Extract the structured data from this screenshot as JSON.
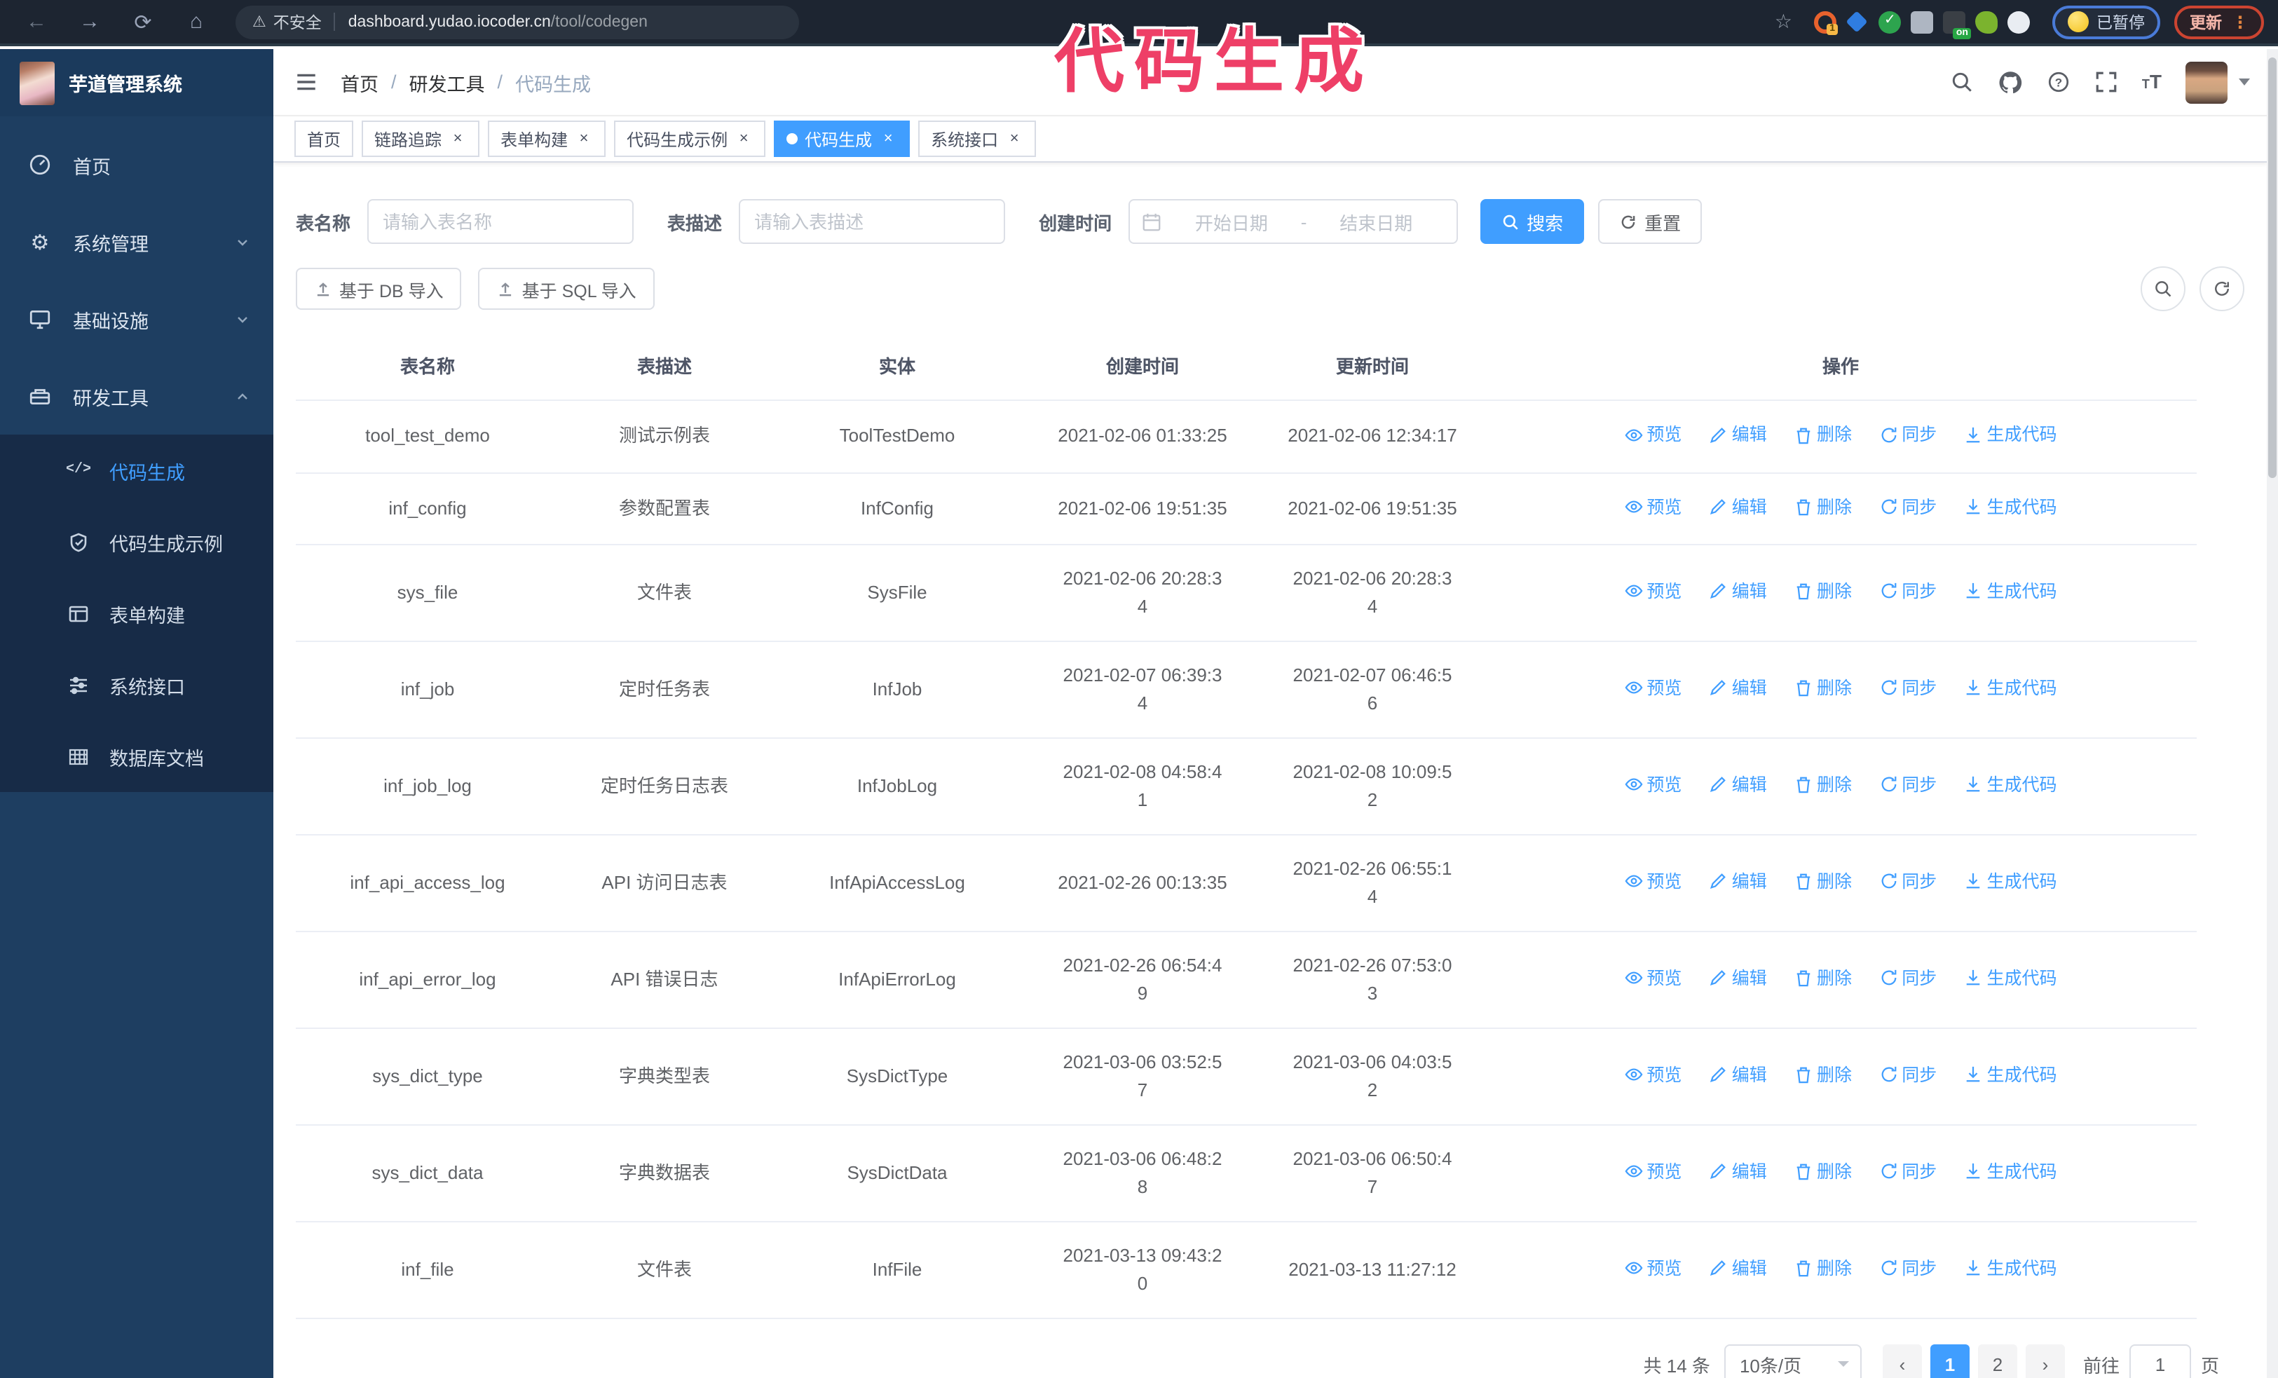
{
  "browser": {
    "security_label": "不安全",
    "url_host": "dashboard.yudao.iocoder.cn",
    "url_path": "/tool/codegen",
    "ext_badge": "1",
    "on_badge": "on",
    "paused_label": "已暂停",
    "update_label": "更新",
    "kebab": "⋮"
  },
  "annotation": {
    "text": "代码生成",
    "color": "#ee3f67"
  },
  "sidebar": {
    "logo_title": "芋道管理系统",
    "items": [
      {
        "label": "首页",
        "icon": "dashboard-icon"
      },
      {
        "label": "系统管理",
        "icon": "gear-icon",
        "state": "collapsed"
      },
      {
        "label": "基础设施",
        "icon": "monitor-icon",
        "state": "collapsed"
      },
      {
        "label": "研发工具",
        "icon": "toolbox-icon",
        "state": "expanded"
      }
    ],
    "submenu": [
      {
        "label": "代码生成",
        "icon": "code-icon",
        "active": true
      },
      {
        "label": "代码生成示例",
        "icon": "shield-check-icon",
        "active": false
      },
      {
        "label": "表单构建",
        "icon": "form-icon",
        "active": false
      },
      {
        "label": "系统接口",
        "icon": "sliders-icon",
        "active": false
      },
      {
        "label": "数据库文档",
        "icon": "grid-icon",
        "active": false
      }
    ]
  },
  "navbar": {
    "breadcrumb": [
      "首页",
      "研发工具",
      "代码生成"
    ]
  },
  "tags": [
    {
      "label": "首页",
      "closable": false,
      "active": false
    },
    {
      "label": "链路追踪",
      "closable": true,
      "active": false
    },
    {
      "label": "表单构建",
      "closable": true,
      "active": false
    },
    {
      "label": "代码生成示例",
      "closable": true,
      "active": false
    },
    {
      "label": "代码生成",
      "closable": true,
      "active": true
    },
    {
      "label": "系统接口",
      "closable": true,
      "active": false
    }
  ],
  "filter": {
    "name_label": "表名称",
    "name_placeholder": "请输入表名称",
    "desc_label": "表描述",
    "desc_placeholder": "请输入表描述",
    "time_label": "创建时间",
    "start_placeholder": "开始日期",
    "range_separator": "-",
    "end_placeholder": "结束日期",
    "search_label": "搜索",
    "reset_label": "重置"
  },
  "actions_bar": {
    "import_db_label": "基于 DB 导入",
    "import_sql_label": "基于 SQL 导入"
  },
  "table": {
    "headers": [
      "表名称",
      "表描述",
      "实体",
      "创建时间",
      "更新时间",
      "操作"
    ],
    "row_actions": [
      {
        "icon": "eye-icon",
        "label": "预览"
      },
      {
        "icon": "edit-icon",
        "label": "编辑"
      },
      {
        "icon": "delete-icon",
        "label": "删除"
      },
      {
        "icon": "sync-icon",
        "label": "同步"
      },
      {
        "icon": "download-icon",
        "label": "生成代码"
      }
    ],
    "rows": [
      {
        "name": "tool_test_demo",
        "desc": "测试示例表",
        "entity": "ToolTestDemo",
        "created": "2021-02-06 01:33:25",
        "updated": "2021-02-06 12:34:17"
      },
      {
        "name": "inf_config",
        "desc": "参数配置表",
        "entity": "InfConfig",
        "created": "2021-02-06 19:51:35",
        "updated": "2021-02-06 19:51:35"
      },
      {
        "name": "sys_file",
        "desc": "文件表",
        "entity": "SysFile",
        "created": "2021-02-06 20:28:3\n4",
        "updated": "2021-02-06 20:28:3\n4"
      },
      {
        "name": "inf_job",
        "desc": "定时任务表",
        "entity": "InfJob",
        "created": "2021-02-07 06:39:3\n4",
        "updated": "2021-02-07 06:46:5\n6"
      },
      {
        "name": "inf_job_log",
        "desc": "定时任务日志表",
        "entity": "InfJobLog",
        "created": "2021-02-08 04:58:4\n1",
        "updated": "2021-02-08 10:09:5\n2"
      },
      {
        "name": "inf_api_access_log",
        "desc": "API 访问日志表",
        "entity": "InfApiAccessLog",
        "created": "2021-02-26 00:13:35",
        "updated": "2021-02-26 06:55:1\n4"
      },
      {
        "name": "inf_api_error_log",
        "desc": "API 错误日志",
        "entity": "InfApiErrorLog",
        "created": "2021-02-26 06:54:4\n9",
        "updated": "2021-02-26 07:53:0\n3"
      },
      {
        "name": "sys_dict_type",
        "desc": "字典类型表",
        "entity": "SysDictType",
        "created": "2021-03-06 03:52:5\n7",
        "updated": "2021-03-06 04:03:5\n2"
      },
      {
        "name": "sys_dict_data",
        "desc": "字典数据表",
        "entity": "SysDictData",
        "created": "2021-03-06 06:48:2\n8",
        "updated": "2021-03-06 06:50:4\n7"
      },
      {
        "name": "inf_file",
        "desc": "文件表",
        "entity": "InfFile",
        "created": "2021-03-13 09:43:2\n0",
        "updated": "2021-03-13 11:27:12"
      }
    ]
  },
  "pagination": {
    "total_label": "共 14 条",
    "page_size_label": "10条/页",
    "pages": [
      "1",
      "2"
    ],
    "active_page": "1",
    "goto_label": "前往",
    "goto_value": "1",
    "unit_label": "页"
  },
  "colors": {
    "accent": "#409eff",
    "sidebar_bg": "#1e3e61",
    "submenu_bg": "#172b47",
    "toolbar_bg": "#1d2531",
    "annotation": "#ee3f67"
  }
}
